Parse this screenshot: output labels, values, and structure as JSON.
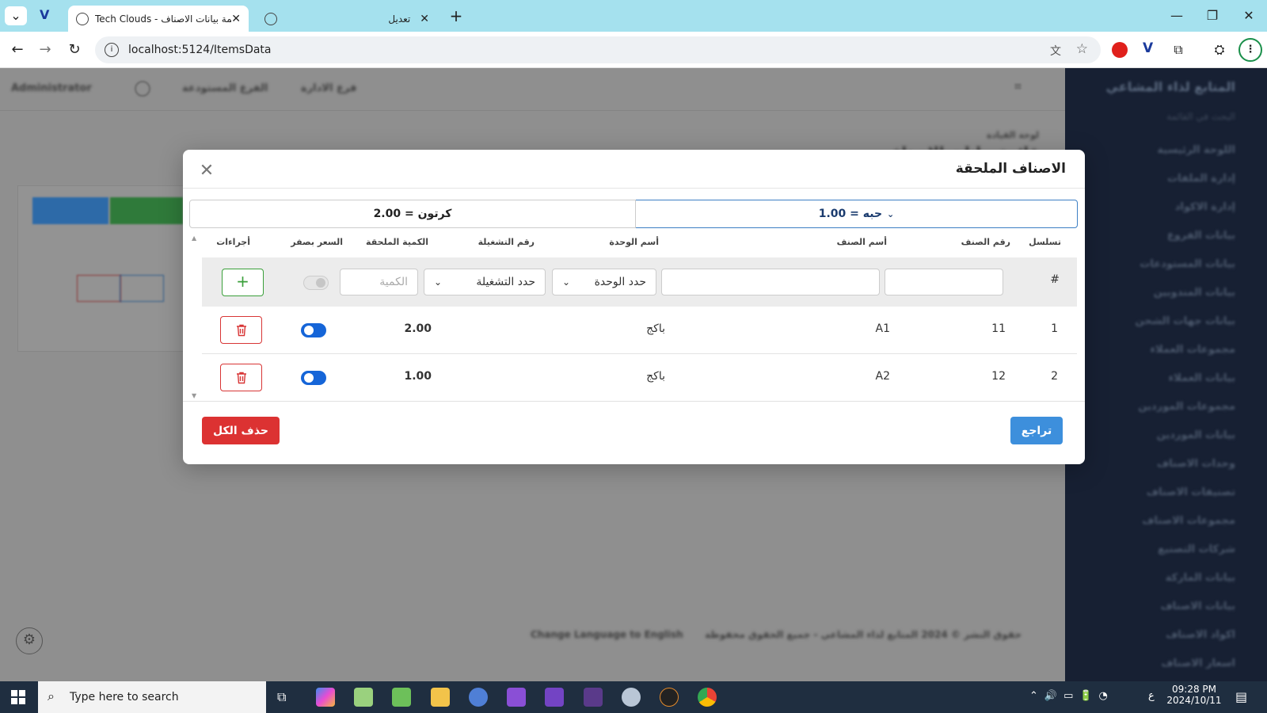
{
  "browser": {
    "active_tab_title": "Tech Clouds - قائمة بيانات الاصناف",
    "inactive_tab_title": "تعديل",
    "url": "localhost:5124/ItemsData"
  },
  "page": {
    "title": "قائمة بيانات الاصناف",
    "breadcrumb": "لوحة القيادة",
    "topbar": [
      "Administrator",
      "الفرع المستودعة",
      "فرع الادارة"
    ],
    "footer_text": "حقوق النشر © 2024 المتابع لذاء المشاعي - جميع الحقوق محفوظة",
    "language_link": "Change Language to English"
  },
  "sidebar": {
    "brand": "المتابع لذاء المشاعي",
    "search_placeholder": "البحث في القائمة",
    "items": [
      "اللوحة الرئيسية",
      "إدارة الملفات",
      "إدارة الاكواد",
      "بيانات الفروع",
      "بيانات المستودعات",
      "بيانات المندوبين",
      "بيانات جهات الشحن",
      "مجموعات العملاء",
      "بيانات العملاء",
      "مجموعات الموردين",
      "بيانات الموردين",
      "وحدات الاصناف",
      "تصنيفات الاصناف",
      "مجموعات الاصناف",
      "شركات التصنيع",
      "بيانات الماركة",
      "بيانات الاصناف",
      "اكواد الاصناف",
      "اسعار الاصناف"
    ]
  },
  "modal": {
    "title": "الاصناف الملحقة",
    "unit_tabs": [
      "حبه = 1.00",
      "كرتون = 2.00"
    ],
    "columns": [
      "تسلسل",
      "رقم الصنف",
      "أسم الصنف",
      "أسم الوحدة",
      "رقم التشغيلة",
      "الكمية الملحقة",
      "السعر بصفر",
      "أجراءات"
    ],
    "entry": {
      "hash": "#",
      "unit_placeholder": "حدد الوحدة",
      "batch_placeholder": "حدد التشغيلة",
      "qty_placeholder": "الكمية",
      "add_label": "+"
    },
    "rows": [
      {
        "seq": "1",
        "item_no": "11",
        "item_name": "A1",
        "unit": "باكج",
        "qty": "2.00",
        "zero_price": true
      },
      {
        "seq": "2",
        "item_no": "12",
        "item_name": "A2",
        "unit": "باكج",
        "qty": "1.00",
        "zero_price": true
      }
    ],
    "back_label": "تراجع",
    "delete_all_label": "حذف الكل"
  },
  "taskbar": {
    "search_placeholder": "Type here to search",
    "time": "09:28 PM",
    "date": "2024/10/11",
    "lang": "ع"
  },
  "colors": {
    "primary": "#3d8fdc",
    "danger": "#dc3232",
    "success": "#3a9f3a",
    "sidebar": "#172033"
  }
}
